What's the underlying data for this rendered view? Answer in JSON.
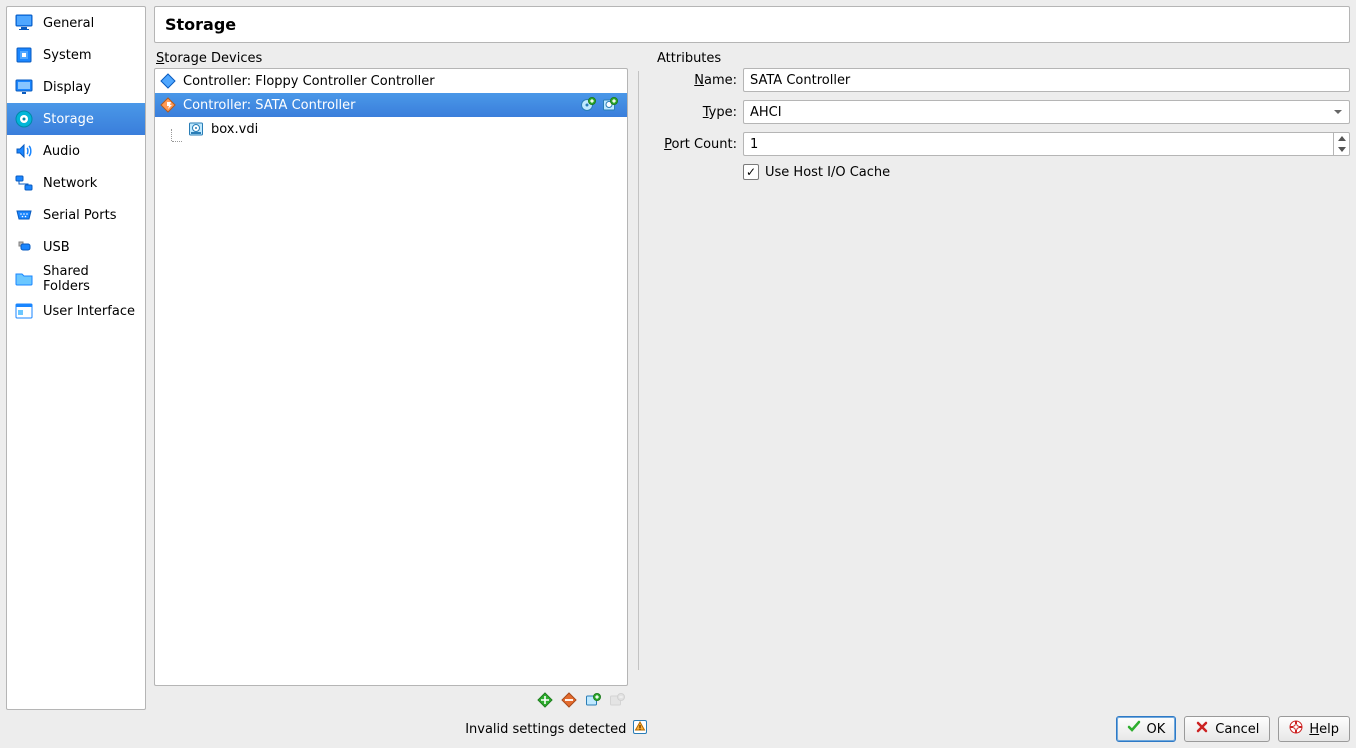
{
  "header": {
    "title": "Storage"
  },
  "sidebar": {
    "items": [
      {
        "label": "General"
      },
      {
        "label": "System"
      },
      {
        "label": "Display"
      },
      {
        "label": "Storage"
      },
      {
        "label": "Audio"
      },
      {
        "label": "Network"
      },
      {
        "label": "Serial Ports"
      },
      {
        "label": "USB"
      },
      {
        "label": "Shared Folders"
      },
      {
        "label": "User Interface"
      }
    ]
  },
  "storage": {
    "section_label": "Storage Devices",
    "tree": {
      "floppy_label": "Controller: Floppy Controller Controller",
      "sata_label": "Controller: SATA Controller",
      "disk_label": "box.vdi"
    }
  },
  "attributes": {
    "section_label": "Attributes",
    "name_label": "Name:",
    "type_label": "Type:",
    "port_label": "Port Count:",
    "name_value": "SATA Controller",
    "type_value": "AHCI",
    "port_value": "1",
    "cache_label": "Use Host I/O Cache",
    "cache_checked": true
  },
  "footer": {
    "status_text": "Invalid settings detected",
    "ok_label": "OK",
    "cancel_label": "Cancel",
    "help_label": "Help"
  }
}
